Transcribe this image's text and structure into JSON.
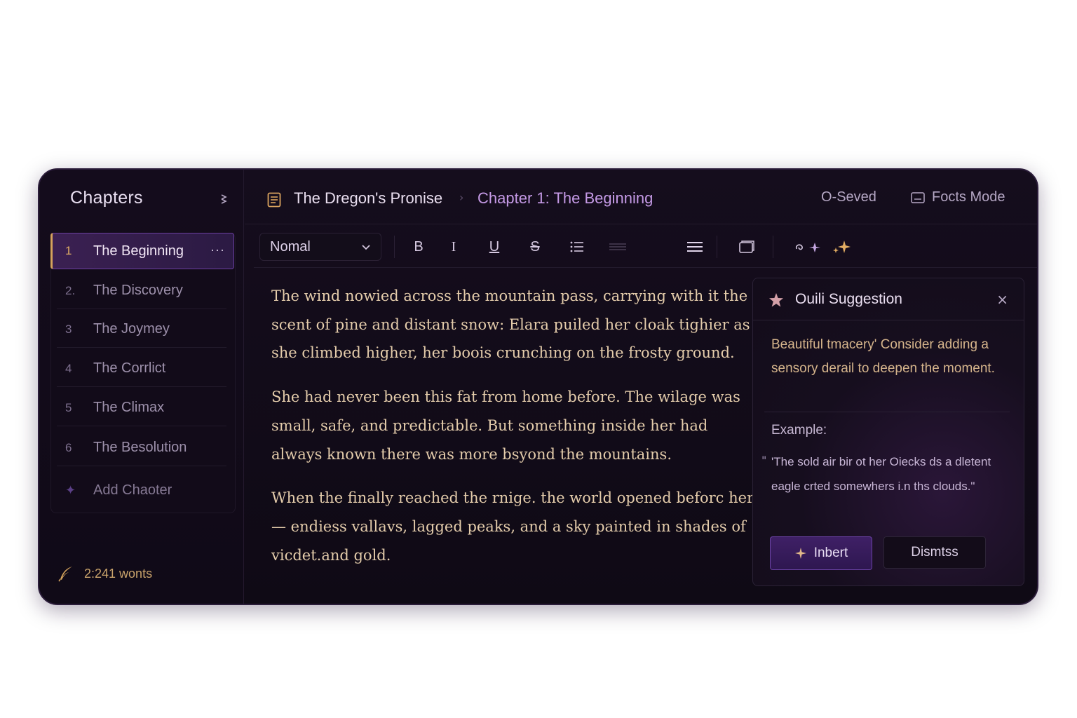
{
  "sidebar": {
    "title": "Chapters",
    "collapse_icon": "collapse-icon",
    "chapters": [
      {
        "num": "1",
        "label": "The Beginning",
        "active": true
      },
      {
        "num": "2.",
        "label": "The Discovery"
      },
      {
        "num": "3",
        "label": "The Joymey"
      },
      {
        "num": "4",
        "label": "The Corrlict"
      },
      {
        "num": "5",
        "label": "The Climax"
      },
      {
        "num": "6",
        "label": "The Besolution"
      }
    ],
    "more_label": "···",
    "add_chapter_label": "Add Chaoter",
    "word_count": "2:241 wonts"
  },
  "header": {
    "book_title": "The Dregon's Pronise",
    "chapter_title": "Chapter 1: The Beginning",
    "save_status": "O-Seved",
    "focus_mode": "Focts Mode"
  },
  "toolbar": {
    "style_select": "Nomal",
    "bold": "B",
    "italic": "I",
    "underline": "U",
    "strikethrough": "S"
  },
  "editor": {
    "paragraphs": [
      "The wind nowied across the mountain pass, carrying with it the scent of pine and distant snow: Elara puiled her cloak tighier as she climbed higher, her boois crunching on the frosty ground.",
      "She had never been this fat from home before. The wilage was small, safe, and predictable. But something inside her had always known there was more bsyond the mountains.",
      "When the finally reached the rnige. the world opened beforc her— endiess vallavs, lagged peaks, and a sky painted in shades of vicdet.and gold."
    ]
  },
  "suggestion": {
    "title": "Ouili Suggestion",
    "close": "×",
    "body": "Beautiful tmacery' Consider adding a sensory derail to deepen the moment.",
    "example_label": "Example:",
    "example_quote_mark": "\"",
    "example_text": "'The sold air bir ot her Oiecks ds a dletent eagle crted somewhers i.n ths clouds.\"",
    "insert_label": "Inbert",
    "dismiss_label": "Dismtss"
  },
  "colors": {
    "accent_purple": "#6a3fa0",
    "accent_gold": "#d5a25c",
    "chapter_title": "#c59ae6",
    "body_text": "#e4ccab"
  }
}
